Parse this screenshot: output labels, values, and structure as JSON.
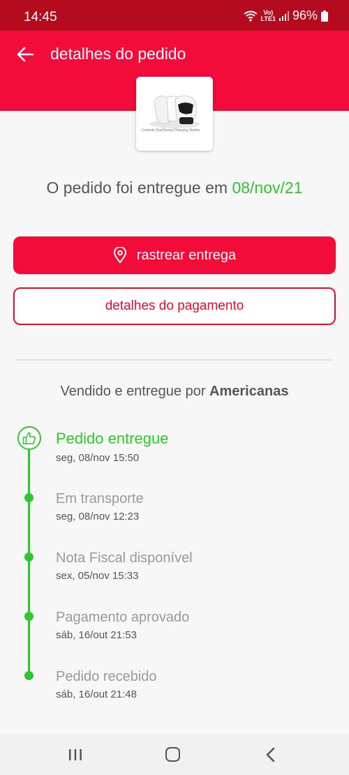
{
  "status_bar": {
    "time": "14:45",
    "network_top": "Vo)",
    "network_bottom": "LTE1",
    "battery": "96%"
  },
  "header": {
    "title": "detalhes do pedido"
  },
  "product": {
    "caption": "Controle DualSense Charging Station"
  },
  "delivery": {
    "prefix": "O pedido foi entregue em",
    "date": "08/nov/21"
  },
  "buttons": {
    "track": "rastrear entrega",
    "payment": "detalhes do pagamento"
  },
  "seller": {
    "prefix": "Vendido e entregue por",
    "name": "Americanas"
  },
  "timeline": [
    {
      "title": "Pedido entregue",
      "date": "seg, 08/nov 15:50"
    },
    {
      "title": "Em transporte",
      "date": "seg, 08/nov 12:23"
    },
    {
      "title": "Nota Fiscal disponível",
      "date": "sex, 05/nov 15:33"
    },
    {
      "title": "Pagamento aprovado",
      "date": "sáb, 16/out 21:53"
    },
    {
      "title": "Pedido recebido",
      "date": "sáb, 16/out 21:48"
    }
  ],
  "colors": {
    "brand": "#f30b3a",
    "status_bar": "#b40b1f",
    "success": "#2fc72f"
  },
  "icons": [
    "wifi-icon",
    "signal-icon",
    "battery-icon",
    "back-arrow-icon",
    "location-pin-icon",
    "thumbs-up-icon",
    "recent-apps-icon",
    "home-icon",
    "nav-back-icon"
  ]
}
